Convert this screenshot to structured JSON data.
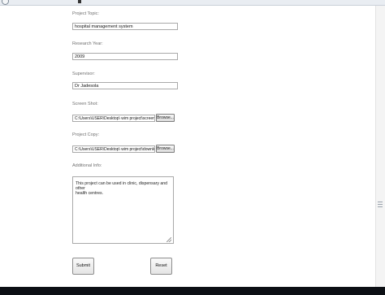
{
  "form": {
    "project_topic": {
      "label": "Project Topic:",
      "value": "hospital management system"
    },
    "research_year": {
      "label": "Research Year:",
      "value": "2009"
    },
    "supervisor": {
      "label": "Supervisor:",
      "value": "Dr Jadesola"
    },
    "screen_shot": {
      "label": "Screen Shot:",
      "value": "C:\\Users\\USER\\Desktop\\ wim project\\screen shot of pro",
      "browse_label": "Browse..."
    },
    "project_copy": {
      "label": "Project Copy:",
      "value": "C:\\Users\\USER\\Desktop\\ wim project\\downloads for pro",
      "browse_label": "Browse..."
    },
    "additional_info": {
      "label": "Additional Info:",
      "value": "This project can be used in clinic, dispensary and other\nhealth centres."
    },
    "buttons": {
      "submit": "Submit",
      "reset": "Reset"
    }
  }
}
